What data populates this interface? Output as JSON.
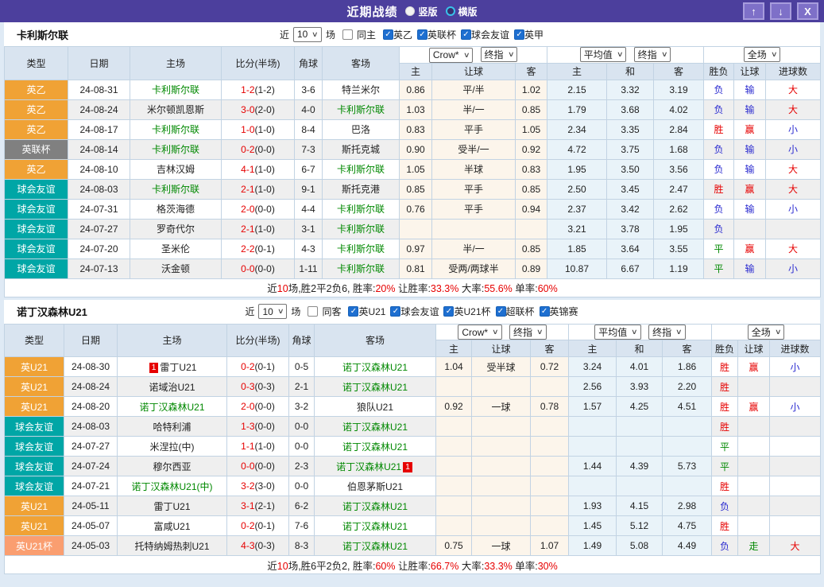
{
  "palette": {
    "red": "#e60000",
    "blue": "#2a2ad0",
    "green": "#008800",
    "cream": "#fcf5eb",
    "lightblue": "#e9f3f9",
    "type_text": "#ffffff"
  },
  "type_colors": {
    "英乙": "#f0a235",
    "英联杯": "#808080",
    "球会友谊": "#00a6a6",
    "英U21": "#f0a235",
    "英U21杯": "#fa9e70"
  },
  "icons": {
    "check": "✓",
    "select_arrow": "∨",
    "up_arrow": "↑",
    "down_arrow": "↓",
    "close": "X"
  },
  "titlebar": {
    "title": "近期战绩",
    "radios": [
      {
        "label": "竖版",
        "selected": true
      },
      {
        "label": "横版",
        "selected": false
      }
    ]
  },
  "labels": {
    "near": "近",
    "games": "场"
  },
  "table_header": {
    "type": "类型",
    "date": "日期",
    "home": "主场",
    "score": "比分(半场)",
    "corner": "角球",
    "away": "客场",
    "odds_home": "主",
    "odds_handicap": "让球",
    "odds_away": "客",
    "avg_home": "主",
    "avg_draw": "和",
    "avg_away": "客",
    "result": "胜负",
    "handicap_result": "让球",
    "goals": "进球数",
    "select_crow": "Crow*",
    "select_final": "终指",
    "select_avg": "平均值",
    "select_final2": "终指",
    "select_scope": "全场"
  },
  "sections": [
    {
      "team": "卡利斯尔联",
      "filter": {
        "count": "10",
        "same_label": "同主",
        "same_checked": false,
        "leagues": [
          {
            "label": "英乙",
            "checked": true
          },
          {
            "label": "英联杯",
            "checked": true
          },
          {
            "label": "球会友谊",
            "checked": true
          },
          {
            "label": "英甲",
            "checked": true
          }
        ]
      },
      "rows": [
        {
          "type": "英乙",
          "date": "24-08-31",
          "home": {
            "name": "卡利斯尔联",
            "green": true
          },
          "ft": "1-2",
          "ht": "(1-2)",
          "corner": "3-6",
          "away": {
            "name": "特兰米尔",
            "green": false
          },
          "crow": [
            "0.86",
            "平/半",
            "1.02"
          ],
          "avg": [
            "2.15",
            "3.32",
            "3.19"
          ],
          "result": {
            "t": "负",
            "c": "blue"
          },
          "hcap": {
            "t": "输",
            "c": "blue"
          },
          "goals": {
            "t": "大",
            "c": "red"
          }
        },
        {
          "type": "英乙",
          "date": "24-08-24",
          "home": {
            "name": "米尔顿凯恩斯",
            "green": false
          },
          "ft": "3-0",
          "ht": "(2-0)",
          "corner": "4-0",
          "away": {
            "name": "卡利斯尔联",
            "green": true
          },
          "crow": [
            "1.03",
            "半/一",
            "0.85"
          ],
          "avg": [
            "1.79",
            "3.68",
            "4.02"
          ],
          "result": {
            "t": "负",
            "c": "blue"
          },
          "hcap": {
            "t": "输",
            "c": "blue"
          },
          "goals": {
            "t": "大",
            "c": "red"
          }
        },
        {
          "type": "英乙",
          "date": "24-08-17",
          "home": {
            "name": "卡利斯尔联",
            "green": true
          },
          "ft": "1-0",
          "ht": "(1-0)",
          "corner": "8-4",
          "away": {
            "name": "巴洛",
            "green": false
          },
          "crow": [
            "0.83",
            "平手",
            "1.05"
          ],
          "avg": [
            "2.34",
            "3.35",
            "2.84"
          ],
          "result": {
            "t": "胜",
            "c": "red"
          },
          "hcap": {
            "t": "赢",
            "c": "red"
          },
          "goals": {
            "t": "小",
            "c": "blue"
          }
        },
        {
          "type": "英联杯",
          "date": "24-08-14",
          "home": {
            "name": "卡利斯尔联",
            "green": true
          },
          "ft": "0-2",
          "ht": "(0-0)",
          "corner": "7-3",
          "away": {
            "name": "斯托克城",
            "green": false
          },
          "crow": [
            "0.90",
            "受半/一",
            "0.92"
          ],
          "avg": [
            "4.72",
            "3.75",
            "1.68"
          ],
          "result": {
            "t": "负",
            "c": "blue"
          },
          "hcap": {
            "t": "输",
            "c": "blue"
          },
          "goals": {
            "t": "小",
            "c": "blue"
          }
        },
        {
          "type": "英乙",
          "date": "24-08-10",
          "home": {
            "name": "吉林汉姆",
            "green": false
          },
          "ft": "4-1",
          "ht": "(1-0)",
          "corner": "6-7",
          "away": {
            "name": "卡利斯尔联",
            "green": true
          },
          "crow": [
            "1.05",
            "半球",
            "0.83"
          ],
          "avg": [
            "1.95",
            "3.50",
            "3.56"
          ],
          "result": {
            "t": "负",
            "c": "blue"
          },
          "hcap": {
            "t": "输",
            "c": "blue"
          },
          "goals": {
            "t": "大",
            "c": "red"
          }
        },
        {
          "type": "球会友谊",
          "date": "24-08-03",
          "home": {
            "name": "卡利斯尔联",
            "green": true
          },
          "ft": "2-1",
          "ht": "(1-0)",
          "corner": "9-1",
          "away": {
            "name": "斯托克港",
            "green": false
          },
          "crow": [
            "0.85",
            "平手",
            "0.85"
          ],
          "avg": [
            "2.50",
            "3.45",
            "2.47"
          ],
          "result": {
            "t": "胜",
            "c": "red"
          },
          "hcap": {
            "t": "赢",
            "c": "red"
          },
          "goals": {
            "t": "大",
            "c": "red"
          }
        },
        {
          "type": "球会友谊",
          "date": "24-07-31",
          "home": {
            "name": "格茨海德",
            "green": false
          },
          "ft": "2-0",
          "ht": "(0-0)",
          "corner": "4-4",
          "away": {
            "name": "卡利斯尔联",
            "green": true
          },
          "crow": [
            "0.76",
            "平手",
            "0.94"
          ],
          "avg": [
            "2.37",
            "3.42",
            "2.62"
          ],
          "result": {
            "t": "负",
            "c": "blue"
          },
          "hcap": {
            "t": "输",
            "c": "blue"
          },
          "goals": {
            "t": "小",
            "c": "blue"
          }
        },
        {
          "type": "球会友谊",
          "date": "24-07-27",
          "home": {
            "name": "罗奇代尔",
            "green": false
          },
          "ft": "2-1",
          "ht": "(1-0)",
          "corner": "3-1",
          "away": {
            "name": "卡利斯尔联",
            "green": true
          },
          "crow": [
            "",
            "",
            ""
          ],
          "avg": [
            "3.21",
            "3.78",
            "1.95"
          ],
          "result": {
            "t": "负",
            "c": "blue"
          },
          "hcap": null,
          "goals": null
        },
        {
          "type": "球会友谊",
          "date": "24-07-20",
          "home": {
            "name": "圣米伦",
            "green": false
          },
          "ft": "2-2",
          "ht": "(0-1)",
          "corner": "4-3",
          "away": {
            "name": "卡利斯尔联",
            "green": true
          },
          "crow": [
            "0.97",
            "半/一",
            "0.85"
          ],
          "avg": [
            "1.85",
            "3.64",
            "3.55"
          ],
          "result": {
            "t": "平",
            "c": "green"
          },
          "hcap": {
            "t": "赢",
            "c": "red"
          },
          "goals": {
            "t": "大",
            "c": "red"
          }
        },
        {
          "type": "球会友谊",
          "date": "24-07-13",
          "home": {
            "name": "沃金顿",
            "green": false
          },
          "ft": "0-0",
          "ht": "(0-0)",
          "corner": "1-11",
          "away": {
            "name": "卡利斯尔联",
            "green": true
          },
          "crow": [
            "0.81",
            "受两/两球半",
            "0.89"
          ],
          "avg": [
            "10.87",
            "6.67",
            "1.19"
          ],
          "result": {
            "t": "平",
            "c": "green"
          },
          "hcap": {
            "t": "输",
            "c": "blue"
          },
          "goals": {
            "t": "小",
            "c": "blue"
          }
        }
      ],
      "summary": [
        {
          "text": "近",
          "red": false
        },
        {
          "text": "10",
          "red": true
        },
        {
          "text": "场,胜2平2负6, 胜率:",
          "red": false
        },
        {
          "text": "20%",
          "red": true
        },
        {
          "text": " 让胜率:",
          "red": false
        },
        {
          "text": "33.3%",
          "red": true
        },
        {
          "text": " 大率:",
          "red": false
        },
        {
          "text": "55.6%",
          "red": true
        },
        {
          "text": " 单率:",
          "red": false
        },
        {
          "text": "60%",
          "red": true
        }
      ]
    },
    {
      "team": "诺丁汉森林U21",
      "filter": {
        "count": "10",
        "same_label": "同客",
        "same_checked": false,
        "leagues": [
          {
            "label": "英U21",
            "checked": true
          },
          {
            "label": "球会友谊",
            "checked": true
          },
          {
            "label": "英U21杯",
            "checked": true
          },
          {
            "label": "超联杯",
            "checked": true
          },
          {
            "label": "英锦赛",
            "checked": true
          }
        ]
      },
      "rows": [
        {
          "type": "英U21",
          "date": "24-08-30",
          "home": {
            "name": "雷丁U21",
            "green": false,
            "badge": "1",
            "badge_pos": "before"
          },
          "ft": "0-2",
          "ht": "(0-1)",
          "corner": "0-5",
          "away": {
            "name": "诺丁汉森林U21",
            "green": true
          },
          "crow": [
            "1.04",
            "受半球",
            "0.72"
          ],
          "avg": [
            "3.24",
            "4.01",
            "1.86"
          ],
          "result": {
            "t": "胜",
            "c": "red"
          },
          "hcap": {
            "t": "赢",
            "c": "red"
          },
          "goals": {
            "t": "小",
            "c": "blue"
          }
        },
        {
          "type": "英U21",
          "date": "24-08-24",
          "home": {
            "name": "诺域治U21",
            "green": false
          },
          "ft": "0-3",
          "ht": "(0-3)",
          "corner": "2-1",
          "away": {
            "name": "诺丁汉森林U21",
            "green": true
          },
          "crow": [
            "",
            "",
            ""
          ],
          "avg": [
            "2.56",
            "3.93",
            "2.20"
          ],
          "result": {
            "t": "胜",
            "c": "red"
          },
          "hcap": null,
          "goals": null
        },
        {
          "type": "英U21",
          "date": "24-08-20",
          "home": {
            "name": "诺丁汉森林U21",
            "green": true
          },
          "ft": "2-0",
          "ht": "(0-0)",
          "corner": "3-2",
          "away": {
            "name": "狼队U21",
            "green": false
          },
          "crow": [
            "0.92",
            "一球",
            "0.78"
          ],
          "avg": [
            "1.57",
            "4.25",
            "4.51"
          ],
          "result": {
            "t": "胜",
            "c": "red"
          },
          "hcap": {
            "t": "赢",
            "c": "red"
          },
          "goals": {
            "t": "小",
            "c": "blue"
          }
        },
        {
          "type": "球会友谊",
          "date": "24-08-03",
          "home": {
            "name": "哈特利浦",
            "green": false
          },
          "ft": "1-3",
          "ht": "(0-0)",
          "corner": "0-0",
          "away": {
            "name": "诺丁汉森林U21",
            "green": true
          },
          "crow": [
            "",
            "",
            ""
          ],
          "avg": [
            "",
            "",
            ""
          ],
          "result": {
            "t": "胜",
            "c": "red"
          },
          "hcap": null,
          "goals": null
        },
        {
          "type": "球会友谊",
          "date": "24-07-27",
          "home": {
            "name": "米涅拉(中)",
            "green": false
          },
          "ft": "1-1",
          "ht": "(1-0)",
          "corner": "0-0",
          "away": {
            "name": "诺丁汉森林U21",
            "green": true
          },
          "crow": [
            "",
            "",
            ""
          ],
          "avg": [
            "",
            "",
            ""
          ],
          "result": {
            "t": "平",
            "c": "green"
          },
          "hcap": null,
          "goals": null
        },
        {
          "type": "球会友谊",
          "date": "24-07-24",
          "home": {
            "name": "穆尔西亚",
            "green": false
          },
          "ft": "0-0",
          "ht": "(0-0)",
          "corner": "2-3",
          "away": {
            "name": "诺丁汉森林U21",
            "green": true,
            "badge": "1",
            "badge_pos": "after"
          },
          "crow": [
            "",
            "",
            ""
          ],
          "avg": [
            "1.44",
            "4.39",
            "5.73"
          ],
          "result": {
            "t": "平",
            "c": "green"
          },
          "hcap": null,
          "goals": null
        },
        {
          "type": "球会友谊",
          "date": "24-07-21",
          "home": {
            "name": "诺丁汉森林U21(中)",
            "green": true
          },
          "ft": "3-2",
          "ht": "(3-0)",
          "corner": "0-0",
          "away": {
            "name": "伯恩茅斯U21",
            "green": false
          },
          "crow": [
            "",
            "",
            ""
          ],
          "avg": [
            "",
            "",
            ""
          ],
          "result": {
            "t": "胜",
            "c": "red"
          },
          "hcap": null,
          "goals": null
        },
        {
          "type": "英U21",
          "date": "24-05-11",
          "home": {
            "name": "雷丁U21",
            "green": false
          },
          "ft": "3-1",
          "ht": "(2-1)",
          "corner": "6-2",
          "away": {
            "name": "诺丁汉森林U21",
            "green": true
          },
          "crow": [
            "",
            "",
            ""
          ],
          "avg": [
            "1.93",
            "4.15",
            "2.98"
          ],
          "result": {
            "t": "负",
            "c": "blue"
          },
          "hcap": null,
          "goals": null
        },
        {
          "type": "英U21",
          "date": "24-05-07",
          "home": {
            "name": "富咸U21",
            "green": false
          },
          "ft": "0-2",
          "ht": "(0-1)",
          "corner": "7-6",
          "away": {
            "name": "诺丁汉森林U21",
            "green": true
          },
          "crow": [
            "",
            "",
            ""
          ],
          "avg": [
            "1.45",
            "5.12",
            "4.75"
          ],
          "result": {
            "t": "胜",
            "c": "red"
          },
          "hcap": null,
          "goals": null
        },
        {
          "type": "英U21杯",
          "date": "24-05-03",
          "home": {
            "name": "托特纳姆热刺U21",
            "green": false
          },
          "ft": "4-3",
          "ht": "(0-3)",
          "corner": "8-3",
          "away": {
            "name": "诺丁汉森林U21",
            "green": true
          },
          "crow": [
            "0.75",
            "一球",
            "1.07"
          ],
          "avg": [
            "1.49",
            "5.08",
            "4.49"
          ],
          "result": {
            "t": "负",
            "c": "blue"
          },
          "hcap": {
            "t": "走",
            "c": "green"
          },
          "goals": {
            "t": "大",
            "c": "red"
          }
        }
      ],
      "summary": [
        {
          "text": "近",
          "red": false
        },
        {
          "text": "10",
          "red": true
        },
        {
          "text": "场,胜6平2负2, 胜率:",
          "red": false
        },
        {
          "text": "60%",
          "red": true
        },
        {
          "text": " 让胜率:",
          "red": false
        },
        {
          "text": "66.7%",
          "red": true
        },
        {
          "text": " 大率:",
          "red": false
        },
        {
          "text": "33.3%",
          "red": true
        },
        {
          "text": " 单率:",
          "red": false
        },
        {
          "text": "30%",
          "red": true
        }
      ]
    }
  ]
}
